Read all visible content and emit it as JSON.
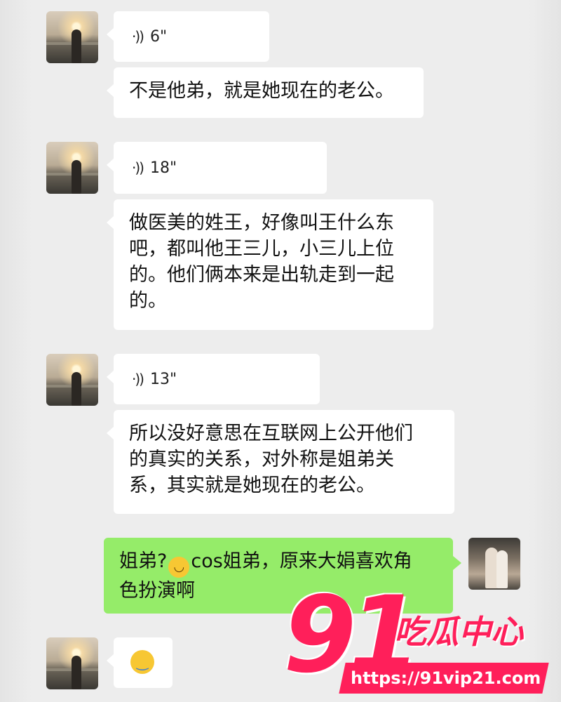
{
  "messages": [
    {
      "type": "voice",
      "sender": "other",
      "duration": "6\""
    },
    {
      "type": "text",
      "sender": "other",
      "text": "不是他弟，就是她现在的老公。"
    },
    {
      "type": "voice",
      "sender": "other",
      "duration": "18\""
    },
    {
      "type": "text",
      "sender": "other",
      "lines": [
        "做医美的姓王，好像叫王什么东",
        "吧，都叫他王三儿，小三儿上位",
        "的。他们俩本来是出轨走到一起",
        "的。"
      ]
    },
    {
      "type": "voice",
      "sender": "other",
      "duration": "13\""
    },
    {
      "type": "text",
      "sender": "other",
      "lines": [
        "所以没好意思在互联网上公开他们",
        "的真实的关系，对外称是姐弟关",
        "系，其实就是她现在的老公。"
      ]
    },
    {
      "type": "text",
      "sender": "me",
      "line1_before": "姐弟?",
      "emoji": "grin-emoji",
      "line1_after": "cos姐弟，原来大娟喜欢角",
      "line2": "色扮演啊"
    },
    {
      "type": "emoji",
      "sender": "other",
      "emoji": "crying-laughing-emoji"
    }
  ],
  "watermark": {
    "number": "91",
    "name": "吃瓜中心",
    "url": "https://91vip21.com"
  },
  "colors": {
    "background": "#ededed",
    "incoming_bubble": "#ffffff",
    "outgoing_bubble": "#95ec69",
    "watermark": "#ff1f5a"
  },
  "icons": {
    "voice": "voice-wave-icon"
  }
}
